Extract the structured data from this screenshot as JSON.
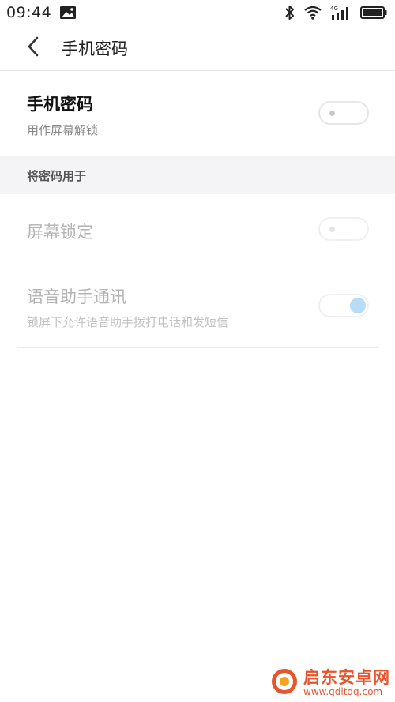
{
  "status_bar": {
    "time": "09:44",
    "network_label": "4G",
    "icons": [
      "image-notification-icon",
      "bluetooth-icon",
      "wifi-icon",
      "signal-icon",
      "battery-icon"
    ]
  },
  "header": {
    "title": "手机密码",
    "back_icon": "chevron-left-icon"
  },
  "main_setting": {
    "title": "手机密码",
    "subtitle": "用作屏幕解锁",
    "enabled": false
  },
  "section": {
    "title": "将密码用于"
  },
  "items": [
    {
      "title": "屏幕锁定",
      "subtitle": "",
      "enabled": false,
      "disabled": true
    },
    {
      "title": "语音助手通讯",
      "subtitle": "锁屏下允许语音助手拨打电话和发短信",
      "enabled": true,
      "disabled": true
    }
  ],
  "watermark": {
    "name": "启东安卓网",
    "url": "www.qdltdq.com"
  },
  "colors": {
    "accent": "#a9d4f6",
    "section_bg": "#f4f4f6",
    "disabled_text": "#b3b3b3",
    "watermark": "#e8542c"
  }
}
